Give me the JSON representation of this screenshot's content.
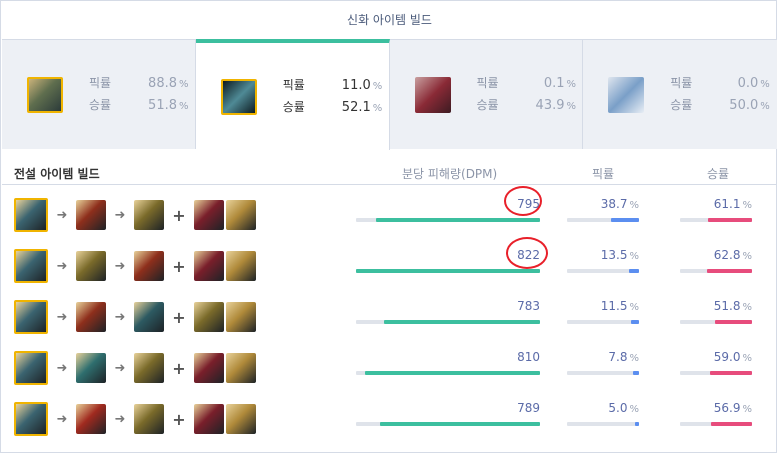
{
  "title": "신화 아이템 빌드",
  "pick_label": "픽률",
  "win_label": "승률",
  "pct_sign": "%",
  "mythic_tabs": [
    {
      "pick": "88.8",
      "win": "51.8",
      "icon": "mythic-item-icon-1",
      "color": "#6b7a55"
    },
    {
      "pick": "11.0",
      "win": "52.1",
      "icon": "mythic-item-icon-2",
      "color": "#3a5f6e"
    },
    {
      "pick": "0.1",
      "win": "43.9",
      "icon": "mythic-item-icon-3",
      "color": "#9a3b45"
    },
    {
      "pick": "0.0",
      "win": "50.0",
      "icon": "mythic-item-icon-4",
      "color": "#6f8eb8"
    }
  ],
  "table_headers": {
    "build": "전설 아이템 빌드",
    "dpm": "분당 피해량(DPM)",
    "pick": "픽률",
    "win": "승률"
  },
  "builds": [
    {
      "dpm": "795",
      "dpm_fill": 0.89,
      "pick": "38.7",
      "pick_fill": 0.39,
      "win": "61.1",
      "win_fill": 0.61
    },
    {
      "dpm": "822",
      "dpm_fill": 1.0,
      "pick": "13.5",
      "pick_fill": 0.135,
      "win": "62.8",
      "win_fill": 0.63
    },
    {
      "dpm": "783",
      "dpm_fill": 0.85,
      "pick": "11.5",
      "pick_fill": 0.115,
      "win": "51.8",
      "win_fill": 0.52
    },
    {
      "dpm": "810",
      "dpm_fill": 0.95,
      "pick": "7.8",
      "pick_fill": 0.078,
      "win": "59.0",
      "win_fill": 0.59
    },
    {
      "dpm": "789",
      "dpm_fill": 0.87,
      "pick": "5.0",
      "pick_fill": 0.05,
      "win": "56.9",
      "win_fill": 0.57
    }
  ],
  "colors": {
    "accent_green": "#3cbf9f",
    "pick_blue": "#5b8ef0",
    "win_pink": "#e74c7c",
    "core_border": "#f0b400",
    "annotation_red": "#e8202a"
  },
  "item_colors": {
    "core": "#3b6470",
    "red_axe": "#8e2f1c",
    "gold_blade": "#7a6a2a",
    "crimson": "#7a1f2b",
    "gold_shield": "#b08a3a",
    "teal_blade": "#2d5a62",
    "teal_green": "#2f6f6f",
    "red_sword": "#a02a1f"
  },
  "build_items": [
    [
      [
        "core"
      ],
      [
        "red_axe",
        "gold_blade"
      ],
      [
        "crimson",
        "gold_shield"
      ]
    ],
    [
      [
        "core"
      ],
      [
        "gold_blade",
        "red_axe"
      ],
      [
        "crimson",
        "gold_shield"
      ]
    ],
    [
      [
        "core"
      ],
      [
        "red_axe",
        "teal_blade"
      ],
      [
        "gold_blade",
        "gold_shield"
      ]
    ],
    [
      [
        "core"
      ],
      [
        "teal_green",
        "gold_blade"
      ],
      [
        "crimson",
        "gold_shield"
      ]
    ],
    [
      [
        "core"
      ],
      [
        "red_sword",
        "gold_blade"
      ],
      [
        "crimson",
        "gold_shield"
      ]
    ]
  ]
}
